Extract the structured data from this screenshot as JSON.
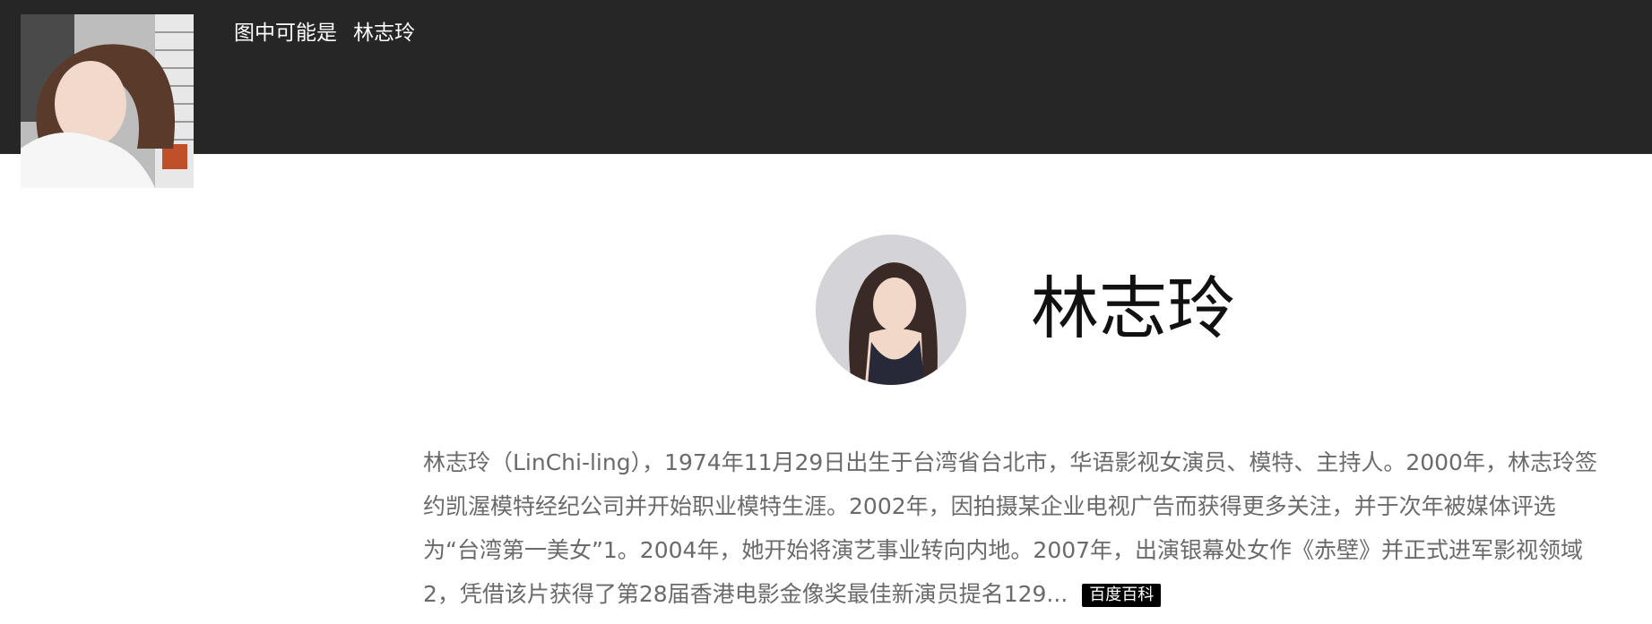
{
  "header": {
    "caption_prefix": "图中可能是",
    "caption_name": "林志玲"
  },
  "thumbnail": {
    "alt": "photo-thumbnail"
  },
  "entity": {
    "name": "林志玲",
    "description": "林志玲（LinChi-ling），1974年11月29日出生于台湾省台北市，华语影视女演员、模特、主持人。2000年，林志玲签约凯渥模特经纪公司并开始职业模特生涯。2002年，因拍摄某企业电视广告而获得更多关注，并于次年被媒体评选为“台湾第一美女”1。2004年，她开始将演艺事业转向内地。2007年，出演银幕处女作《赤壁》并正式进军影视领域2，凭借该片获得了第28届香港电影金像奖最佳新演员提名129...",
    "source_badge": "百度百科"
  },
  "colors": {
    "topbar": "#262626",
    "badge_bg": "#000000",
    "text": "#6a6a6a"
  }
}
